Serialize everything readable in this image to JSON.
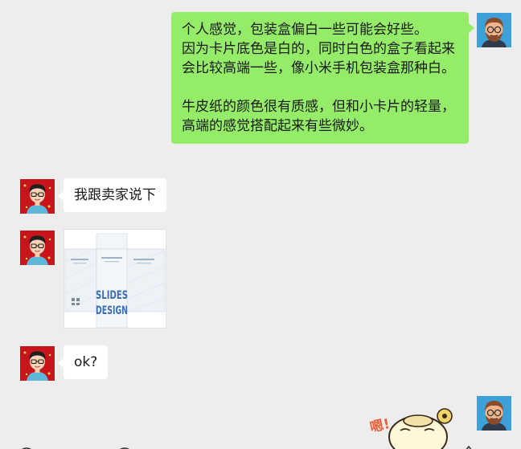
{
  "messages": [
    {
      "sender": "me",
      "paragraphs": [
        "个人感觉，包装盒偏白一些可能会好些。",
        "因为卡片底色是白的，同时白色的盒子看起来会比较高端一些，像小米手机包装盒那种白。",
        "牛皮纸的颜色很有质感，但和小卡片的轻量，高端的感觉搭配起来有些微妙。"
      ]
    },
    {
      "sender": "other",
      "text": "我跟卖家说下"
    },
    {
      "sender": "other",
      "type": "image",
      "image_text": [
        "SLIDES",
        "DESIGN"
      ]
    },
    {
      "sender": "other",
      "text": "ok?"
    },
    {
      "sender": "me",
      "type": "sticker",
      "sticker_text": "嗯!"
    }
  ],
  "colors": {
    "background": "#ededed",
    "my_bubble": "#95ec69",
    "their_bubble": "#ffffff",
    "text": "#191919"
  }
}
